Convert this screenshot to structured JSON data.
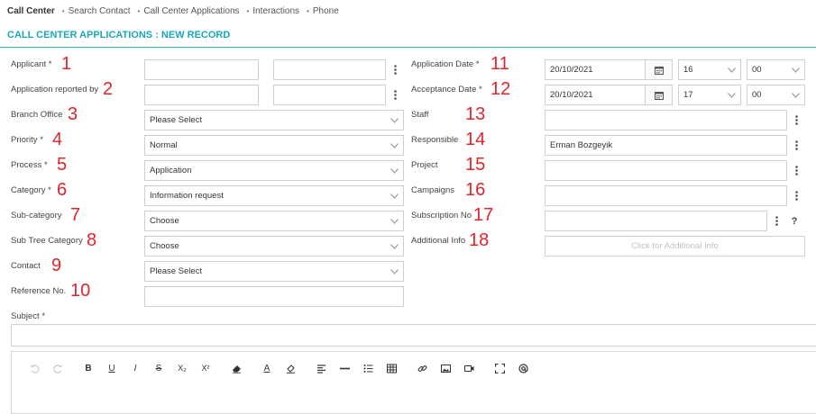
{
  "breadcrumb": [
    "Call Center",
    "Search Contact",
    "Call Center Applications",
    "Interactions",
    "Phone"
  ],
  "breadcrumb_sep": "•",
  "page_title": "CALL CENTER APPLICATIONS : NEW RECORD",
  "left_fields": [
    {
      "label": "Applicant *",
      "num": "1"
    },
    {
      "label": "Application reported by",
      "num": "2"
    },
    {
      "label": "Branch Office",
      "num": "3",
      "value": "Please Select"
    },
    {
      "label": "Priority *",
      "num": "4",
      "value": "Normal"
    },
    {
      "label": "Process *",
      "num": "5",
      "value": "Application"
    },
    {
      "label": "Category *",
      "num": "6",
      "value": "Information request"
    },
    {
      "label": "Sub-category",
      "num": "7",
      "value": "Choose"
    },
    {
      "label": "Sub Tree Category",
      "num": "8",
      "value": "Choose"
    },
    {
      "label": "Contact",
      "num": "9",
      "value": "Please Select"
    },
    {
      "label": "Reference No.",
      "num": "10",
      "value": ""
    }
  ],
  "right_fields": [
    {
      "label": "Application Date *",
      "num": "11",
      "date": "20/10/2021",
      "hour": "16",
      "minute": "00"
    },
    {
      "label": "Acceptance Date *",
      "num": "12",
      "date": "20/10/2021",
      "hour": "17",
      "minute": "00"
    },
    {
      "label": "Staff",
      "num": "13",
      "value": ""
    },
    {
      "label": "Responsible",
      "num": "14",
      "value": "Erman Bozgeyik"
    },
    {
      "label": "Project",
      "num": "15",
      "value": ""
    },
    {
      "label": "Campaigns",
      "num": "16",
      "value": ""
    },
    {
      "label": "Subscription No",
      "num": "17",
      "value": "",
      "help": "?"
    },
    {
      "label": "Additional Info",
      "num": "18",
      "value": "Click for Additional Info"
    }
  ],
  "subject_label": "Subject *",
  "toolbar_labels": {
    "bold": "B",
    "underline": "U",
    "italic": "I",
    "strike": "S",
    "subscript": "X₂",
    "superscript": "X²",
    "text_color": "A"
  }
}
